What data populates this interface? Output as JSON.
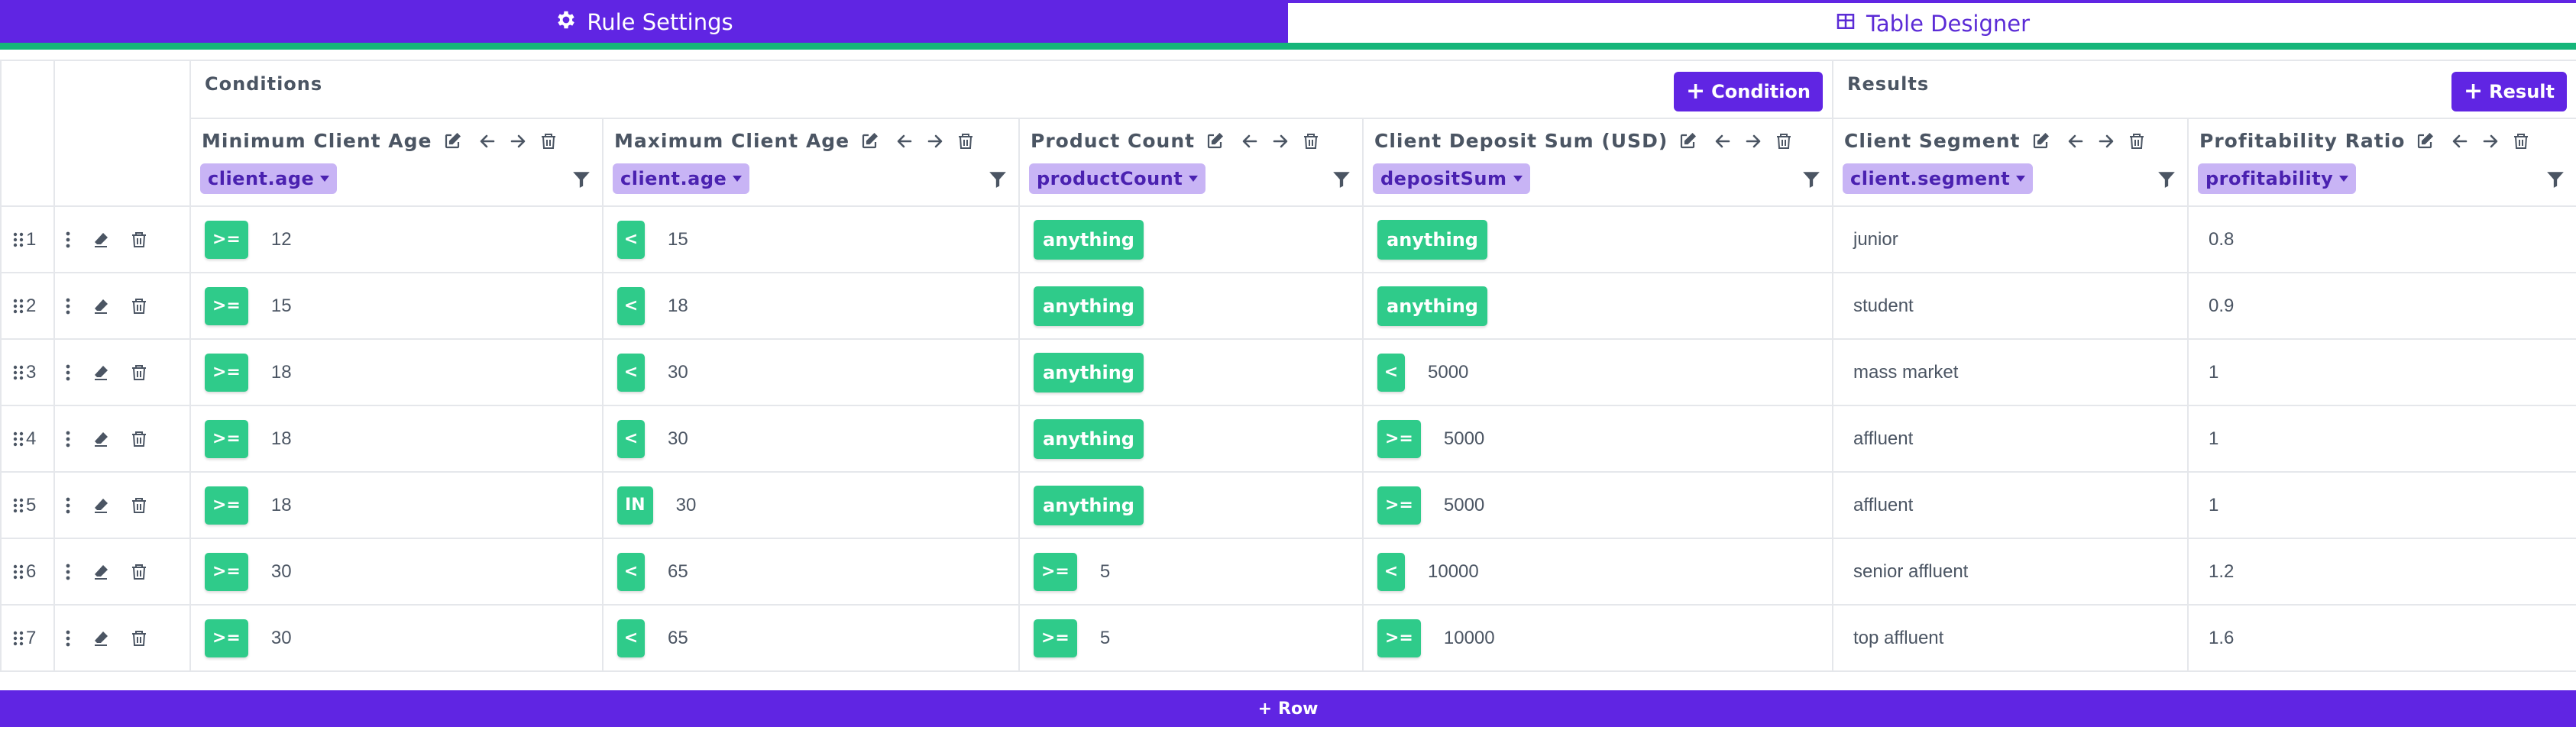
{
  "tabs": [
    {
      "label": "Rule Settings",
      "icon": "gear-icon",
      "active": true
    },
    {
      "label": "Table Designer",
      "icon": "table-icon",
      "active": false
    }
  ],
  "sections": {
    "conditions": {
      "title": "Conditions",
      "add_label": "Condition"
    },
    "results": {
      "title": "Results",
      "add_label": "Result"
    }
  },
  "columns": [
    {
      "title": "Minimum Client Age",
      "field": "client.age"
    },
    {
      "title": "Maximum Client Age",
      "field": "client.age"
    },
    {
      "title": "Product Count",
      "field": "productCount"
    },
    {
      "title": "Client Deposit Sum (USD)",
      "field": "depositSum"
    },
    {
      "title": "Client Segment",
      "field": "client.segment"
    },
    {
      "title": "Profitability Ratio",
      "field": "profitability"
    }
  ],
  "rows": [
    {
      "n": "1",
      "cells": [
        {
          "op": ">=",
          "v": "12"
        },
        {
          "op": "<",
          "v": "15"
        },
        {
          "op": "anything",
          "v": ""
        },
        {
          "op": "anything",
          "v": ""
        }
      ],
      "results": [
        "junior",
        "0.8"
      ]
    },
    {
      "n": "2",
      "cells": [
        {
          "op": ">=",
          "v": "15"
        },
        {
          "op": "<",
          "v": "18"
        },
        {
          "op": "anything",
          "v": ""
        },
        {
          "op": "anything",
          "v": ""
        }
      ],
      "results": [
        "student",
        "0.9"
      ]
    },
    {
      "n": "3",
      "cells": [
        {
          "op": ">=",
          "v": "18"
        },
        {
          "op": "<",
          "v": "30"
        },
        {
          "op": "anything",
          "v": ""
        },
        {
          "op": "<",
          "v": "5000"
        }
      ],
      "results": [
        "mass market",
        "1"
      ]
    },
    {
      "n": "4",
      "cells": [
        {
          "op": ">=",
          "v": "18"
        },
        {
          "op": "<",
          "v": "30"
        },
        {
          "op": "anything",
          "v": ""
        },
        {
          "op": ">=",
          "v": "5000"
        }
      ],
      "results": [
        "affluent",
        "1"
      ]
    },
    {
      "n": "5",
      "cells": [
        {
          "op": ">=",
          "v": "18"
        },
        {
          "op": "IN",
          "v": "30"
        },
        {
          "op": "anything",
          "v": ""
        },
        {
          "op": ">=",
          "v": "5000"
        }
      ],
      "results": [
        "affluent",
        "1"
      ]
    },
    {
      "n": "6",
      "cells": [
        {
          "op": ">=",
          "v": "30"
        },
        {
          "op": "<",
          "v": "65"
        },
        {
          "op": ">=",
          "v": "5"
        },
        {
          "op": "<",
          "v": "10000"
        }
      ],
      "results": [
        "senior affluent",
        "1.2"
      ]
    },
    {
      "n": "7",
      "cells": [
        {
          "op": ">=",
          "v": "30"
        },
        {
          "op": "<",
          "v": "65"
        },
        {
          "op": ">=",
          "v": "5"
        },
        {
          "op": ">=",
          "v": "10000"
        }
      ],
      "results": [
        "top affluent",
        "1.6"
      ]
    }
  ],
  "footer": {
    "add_row_label": "Row"
  },
  "colors": {
    "accent": "#6025e3",
    "operator": "#2fcb8a",
    "field_tag": "#c8b4f5",
    "tab_underline": "#16b67a"
  }
}
